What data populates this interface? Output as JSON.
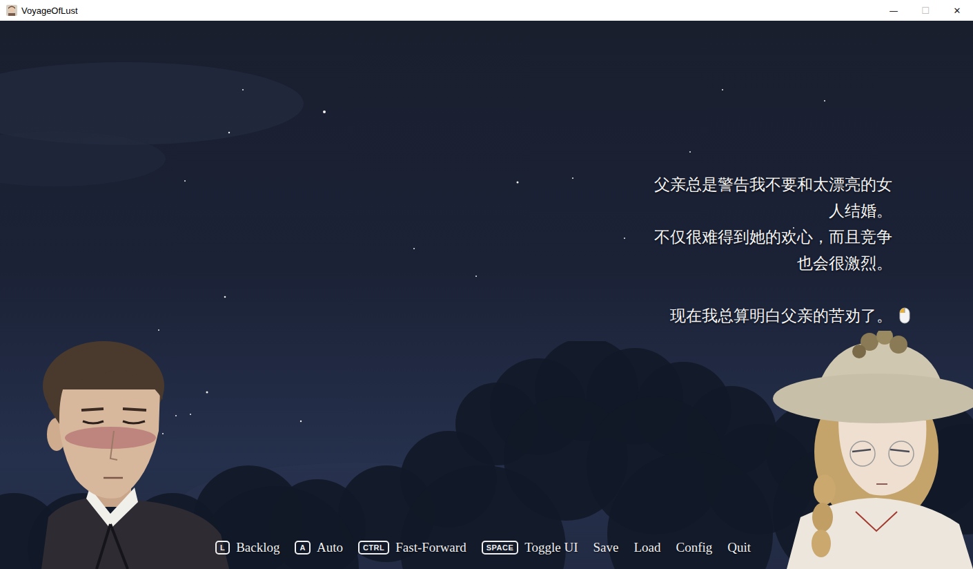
{
  "window": {
    "title": "VoyageOfLust",
    "controls": [
      {
        "label": "—",
        "disabled": false
      },
      {
        "label": "☐",
        "disabled": true
      },
      {
        "label": "✕",
        "disabled": false
      }
    ]
  },
  "dialogue": {
    "paragraphs": [
      [
        "父亲总是警告我不要和太漂亮的女",
        "人结婚。",
        "不仅很难得到她的欢心，而且竞争",
        "也会很激烈。"
      ],
      [
        "现在我总算明白父亲的苦劝了。"
      ]
    ]
  },
  "menu": [
    {
      "kind": "shortcut",
      "key": "L",
      "label": "Backlog"
    },
    {
      "kind": "shortcut",
      "key": "A",
      "label": "Auto"
    },
    {
      "kind": "shortcut",
      "key": "CTRL",
      "label": "Fast-Forward"
    },
    {
      "kind": "shortcut",
      "key": "SPACE",
      "label": "Toggle UI"
    },
    {
      "kind": "button",
      "label": "Save"
    },
    {
      "kind": "button",
      "label": "Load"
    },
    {
      "kind": "button",
      "label": "Config"
    },
    {
      "kind": "button",
      "label": "Quit"
    }
  ]
}
